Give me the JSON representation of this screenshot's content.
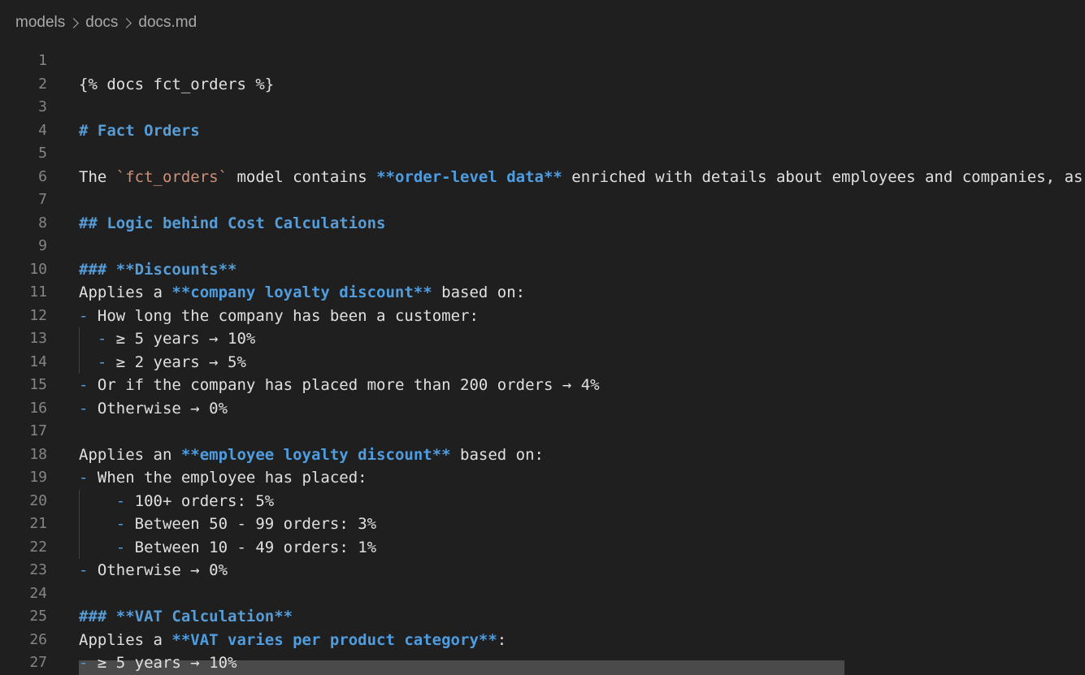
{
  "breadcrumb": [
    "models",
    "docs",
    "docs.md"
  ],
  "lines": [
    {
      "n": "1",
      "segs": []
    },
    {
      "n": "2",
      "segs": [
        {
          "t": "{% docs fct_orders %}",
          "c": ""
        }
      ]
    },
    {
      "n": "3",
      "segs": []
    },
    {
      "n": "4",
      "segs": [
        {
          "t": "# Fact Orders",
          "c": "c-blue"
        }
      ]
    },
    {
      "n": "5",
      "segs": []
    },
    {
      "n": "6",
      "segs": [
        {
          "t": "The ",
          "c": ""
        },
        {
          "t": "`fct_orders`",
          "c": "c-code"
        },
        {
          "t": " model contains ",
          "c": ""
        },
        {
          "t": "**order-level data**",
          "c": "c-bold"
        },
        {
          "t": " enriched with details about employees and companies, as",
          "c": ""
        }
      ]
    },
    {
      "n": "7",
      "segs": []
    },
    {
      "n": "8",
      "segs": [
        {
          "t": "## Logic behind Cost Calculations",
          "c": "c-blue"
        }
      ]
    },
    {
      "n": "9",
      "segs": []
    },
    {
      "n": "10",
      "segs": [
        {
          "t": "### **Discounts**",
          "c": "c-blue"
        }
      ]
    },
    {
      "n": "11",
      "segs": [
        {
          "t": "Applies a ",
          "c": ""
        },
        {
          "t": "**company loyalty discount**",
          "c": "c-bold"
        },
        {
          "t": " based on:",
          "c": ""
        }
      ]
    },
    {
      "n": "12",
      "segs": [
        {
          "t": "-",
          "c": "c-dash"
        },
        {
          "t": " How long the company has been a customer:",
          "c": ""
        }
      ]
    },
    {
      "n": "13",
      "segs": [
        {
          "t": "  ",
          "c": ""
        },
        {
          "t": "-",
          "c": "c-dash"
        },
        {
          "t": " ≥ 5 years → 10%",
          "c": ""
        }
      ]
    },
    {
      "n": "14",
      "segs": [
        {
          "t": "  ",
          "c": ""
        },
        {
          "t": "-",
          "c": "c-dash"
        },
        {
          "t": " ≥ 2 years → 5%",
          "c": ""
        }
      ]
    },
    {
      "n": "15",
      "segs": [
        {
          "t": "-",
          "c": "c-dash"
        },
        {
          "t": " Or if the company has placed more than 200 orders → 4%",
          "c": ""
        }
      ]
    },
    {
      "n": "16",
      "segs": [
        {
          "t": "-",
          "c": "c-dash"
        },
        {
          "t": " Otherwise → 0%",
          "c": ""
        }
      ]
    },
    {
      "n": "17",
      "segs": []
    },
    {
      "n": "18",
      "segs": [
        {
          "t": "Applies an ",
          "c": ""
        },
        {
          "t": "**employee loyalty discount**",
          "c": "c-bold"
        },
        {
          "t": " based on:",
          "c": ""
        }
      ]
    },
    {
      "n": "19",
      "segs": [
        {
          "t": "-",
          "c": "c-dash"
        },
        {
          "t": " When the employee has placed:",
          "c": ""
        }
      ]
    },
    {
      "n": "20",
      "segs": [
        {
          "t": "    ",
          "c": ""
        },
        {
          "t": "-",
          "c": "c-dash"
        },
        {
          "t": " 100+ orders: 5%",
          "c": ""
        }
      ]
    },
    {
      "n": "21",
      "segs": [
        {
          "t": "    ",
          "c": ""
        },
        {
          "t": "-",
          "c": "c-dash"
        },
        {
          "t": " Between 50 - 99 orders: 3%",
          "c": ""
        }
      ]
    },
    {
      "n": "22",
      "segs": [
        {
          "t": "    ",
          "c": ""
        },
        {
          "t": "-",
          "c": "c-dash"
        },
        {
          "t": " Between 10 - 49 orders: 1%",
          "c": ""
        }
      ]
    },
    {
      "n": "23",
      "segs": [
        {
          "t": "-",
          "c": "c-dash"
        },
        {
          "t": " Otherwise → 0%",
          "c": ""
        }
      ]
    },
    {
      "n": "24",
      "segs": []
    },
    {
      "n": "25",
      "segs": [
        {
          "t": "### **VAT Calculation**",
          "c": "c-blue"
        }
      ]
    },
    {
      "n": "26",
      "segs": [
        {
          "t": "Applies a ",
          "c": ""
        },
        {
          "t": "**VAT varies per product category**",
          "c": "c-bold"
        },
        {
          "t": ":",
          "c": ""
        }
      ]
    },
    {
      "n": "27",
      "segs": [
        {
          "t": "-",
          "c": "c-dash"
        },
        {
          "t": " ≥ 5 years → 10%",
          "c": ""
        }
      ]
    }
  ]
}
